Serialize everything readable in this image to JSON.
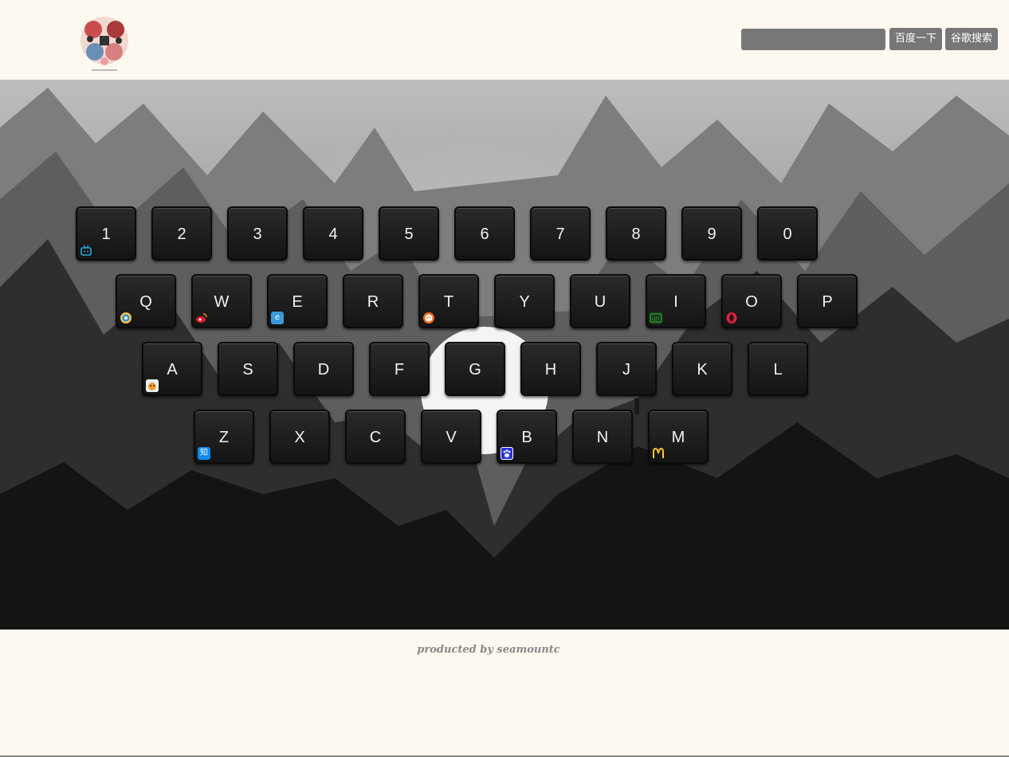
{
  "header": {
    "search_placeholder": "",
    "baidu_label": "百度一下",
    "google_label": "谷歌搜索"
  },
  "keyboard": {
    "rows": [
      [
        {
          "key": "1",
          "icon": "bilibili-icon"
        },
        {
          "key": "2"
        },
        {
          "key": "3"
        },
        {
          "key": "4"
        },
        {
          "key": "5"
        },
        {
          "key": "6"
        },
        {
          "key": "7"
        },
        {
          "key": "8"
        },
        {
          "key": "9"
        },
        {
          "key": "0"
        }
      ],
      [
        {
          "key": "Q",
          "icon": "qq-browser-icon"
        },
        {
          "key": "W",
          "icon": "weibo-icon"
        },
        {
          "key": "E",
          "icon": "ie-browser-icon"
        },
        {
          "key": "R"
        },
        {
          "key": "T",
          "icon": "taobao-icon"
        },
        {
          "key": "Y"
        },
        {
          "key": "U"
        },
        {
          "key": "I",
          "icon": "iqiyi-icon"
        },
        {
          "key": "O",
          "icon": "opera-icon"
        },
        {
          "key": "P"
        }
      ],
      [
        {
          "key": "A",
          "icon": "acfun-icon"
        },
        {
          "key": "S"
        },
        {
          "key": "D"
        },
        {
          "key": "F"
        },
        {
          "key": "G"
        },
        {
          "key": "H"
        },
        {
          "key": "J"
        },
        {
          "key": "K"
        },
        {
          "key": "L"
        }
      ],
      [
        {
          "key": "Z",
          "icon": "zhihu-icon",
          "icon_text": "知"
        },
        {
          "key": "X"
        },
        {
          "key": "C"
        },
        {
          "key": "V"
        },
        {
          "key": "B",
          "icon": "baidu-paw-icon"
        },
        {
          "key": "N"
        },
        {
          "key": "M",
          "icon": "mcdonalds-icon"
        }
      ]
    ]
  },
  "footer": {
    "text": "producted by seamountc"
  }
}
